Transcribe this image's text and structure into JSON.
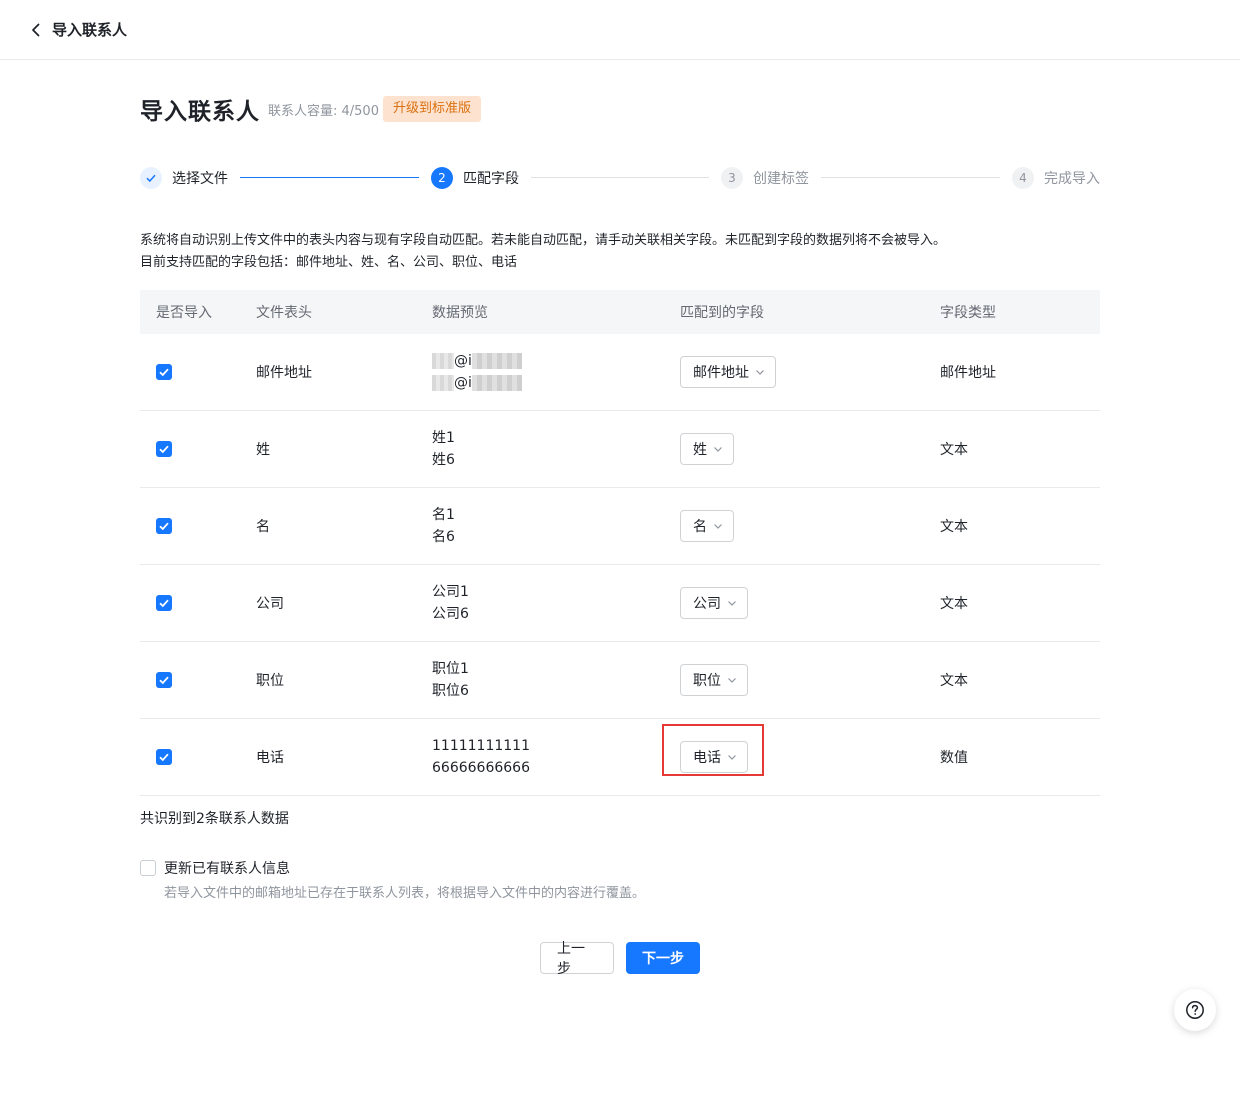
{
  "header": {
    "back_label": "导入联系人"
  },
  "page": {
    "title": "导入联系人",
    "capacity": "联系人容量: 4/500",
    "upgrade_label": "升级到标准版"
  },
  "steps": [
    {
      "number": "1",
      "label": "选择文件",
      "state": "done"
    },
    {
      "number": "2",
      "label": "匹配字段",
      "state": "active"
    },
    {
      "number": "3",
      "label": "创建标签",
      "state": "todo"
    },
    {
      "number": "4",
      "label": "完成导入",
      "state": "todo"
    }
  ],
  "description": {
    "line1": "系统将自动识别上传文件中的表头内容与现有字段自动匹配。若未能自动匹配，请手动关联相关字段。未匹配到字段的数据列将不会被导入。",
    "line2": "目前支持匹配的字段包括：邮件地址、姓、名、公司、职位、电话"
  },
  "table": {
    "headers": [
      "是否导入",
      "文件表头",
      "数据预览",
      "匹配到的字段",
      "字段类型"
    ],
    "email_row": {
      "header": "邮件地址",
      "preview_fragment": "@i",
      "field": "邮件地址",
      "type": "邮件地址"
    },
    "rows": [
      {
        "header": "姓",
        "preview": [
          "姓1",
          "姓6"
        ],
        "field": "姓",
        "type": "文本"
      },
      {
        "header": "名",
        "preview": [
          "名1",
          "名6"
        ],
        "field": "名",
        "type": "文本"
      },
      {
        "header": "公司",
        "preview": [
          "公司1",
          "公司6"
        ],
        "field": "公司",
        "type": "文本"
      },
      {
        "header": "职位",
        "preview": [
          "职位1",
          "职位6"
        ],
        "field": "职位",
        "type": "文本"
      },
      {
        "header": "电话",
        "preview": [
          "11111111111",
          "66666666666"
        ],
        "field": "电话",
        "type": "数值"
      }
    ]
  },
  "summary": {
    "count_text": "共识别到2条联系人数据"
  },
  "update_option": {
    "label": "更新已有联系人信息",
    "hint": "若导入文件中的邮箱地址已存在于联系人列表，将根据导入文件中的内容进行覆盖。",
    "checked": false
  },
  "actions": {
    "prev_label": "上一步",
    "next_label": "下一步"
  },
  "colors": {
    "primary": "#1677ff",
    "upgrade_bg": "#fde3cf",
    "upgrade_text": "#d9700f",
    "highlight": "#e53935"
  },
  "icons": {
    "back": "chevron-left-icon",
    "check": "check-icon",
    "dropdown": "chevron-down-icon",
    "help": "help-icon"
  }
}
